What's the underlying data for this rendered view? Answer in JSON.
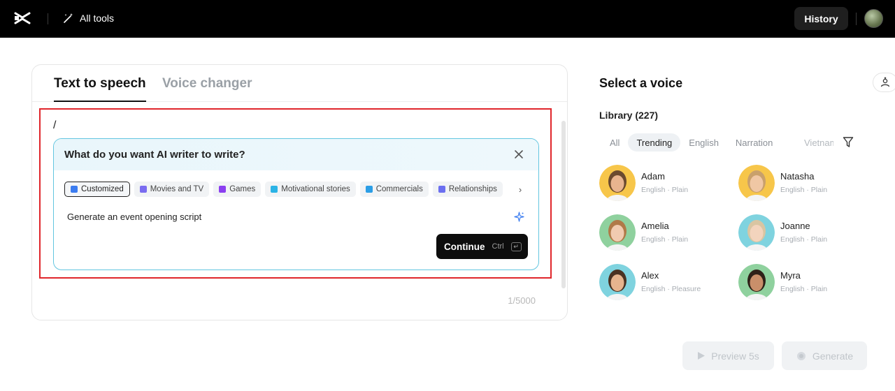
{
  "header": {
    "logo_icon": "capcut-logo-icon",
    "all_tools_label": "All tools",
    "history_label": "History"
  },
  "editor": {
    "tabs": [
      {
        "label": "Text to speech",
        "active": true
      },
      {
        "label": "Voice changer",
        "active": false
      }
    ],
    "input_text": "/",
    "char_counter": "1/5000"
  },
  "ai_writer": {
    "title": "What do you want AI writer to write?",
    "chips": [
      {
        "label": "Customized",
        "selected": true,
        "icon": "edit-icon",
        "color": "#3b7cf0"
      },
      {
        "label": "Movies and TV",
        "selected": false,
        "icon": "film-icon",
        "color": "#7a6cf0"
      },
      {
        "label": "Games",
        "selected": false,
        "icon": "gamepad-icon",
        "color": "#8b3ff0"
      },
      {
        "label": "Motivational stories",
        "selected": false,
        "icon": "hand-icon",
        "color": "#2bb3e6"
      },
      {
        "label": "Commercials",
        "selected": false,
        "icon": "megaphone-icon",
        "color": "#2b9ee6"
      },
      {
        "label": "Relationships",
        "selected": false,
        "icon": "people-icon",
        "color": "#6b6ff0"
      }
    ],
    "prompt": "Generate an event opening script",
    "continue_label": "Continue",
    "shortcut_key": "Ctrl",
    "shortcut_enter": "↵"
  },
  "voice_panel": {
    "title": "Select a voice",
    "library_label": "Library (227)",
    "filters": [
      "All",
      "Trending",
      "English",
      "Narration",
      "Vietnam"
    ],
    "active_filter": "Trending",
    "voices": [
      {
        "name": "Adam",
        "meta": "English · Plain",
        "bg": "#f7c64a",
        "skin": "#e8b48f",
        "hair": "#6b4a2f"
      },
      {
        "name": "Natasha",
        "meta": "English · Plain",
        "bg": "#f7c64a",
        "skin": "#f0c7a4",
        "hair": "#c9a06b"
      },
      {
        "name": "Amelia",
        "meta": "English · Plain",
        "bg": "#8fd19e",
        "skin": "#f1cbb0",
        "hair": "#b07a48"
      },
      {
        "name": "Joanne",
        "meta": "English · Plain",
        "bg": "#7fd3df",
        "skin": "#f3d4bd",
        "hair": "#d9c5a2"
      },
      {
        "name": "Alex",
        "meta": "English · Pleasure",
        "bg": "#7fd3df",
        "skin": "#e6b48e",
        "hair": "#4a3222"
      },
      {
        "name": "Myra",
        "meta": "English · Plain",
        "bg": "#8fd19e",
        "skin": "#c98f6a",
        "hair": "#2e2118"
      }
    ],
    "preview_label": "Preview 5s",
    "generate_label": "Generate"
  }
}
